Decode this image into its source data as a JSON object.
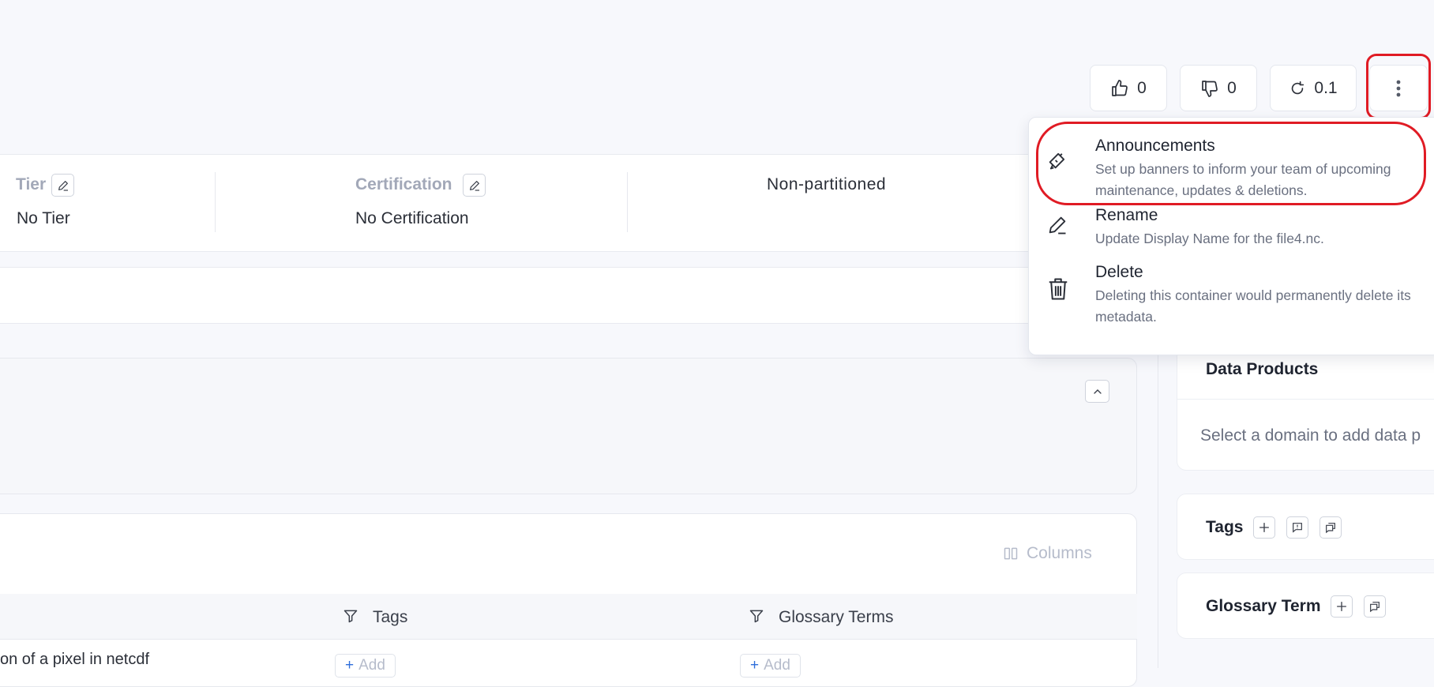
{
  "actions": {
    "upvote_count": "0",
    "downvote_count": "0",
    "version": "0.1"
  },
  "summary": {
    "tier_label": "Tier",
    "tier_value": "No Tier",
    "certification_label": "Certification",
    "certification_value": "No Certification",
    "partition_value": "Non-partitioned"
  },
  "menu": {
    "items": [
      {
        "title": "Announcements",
        "description": "Set up banners to inform your team of upcoming maintenance, updates & deletions.",
        "icon": "megaphone-icon"
      },
      {
        "title": "Rename",
        "description": "Update Display Name for the file4.nc.",
        "icon": "pencil-icon"
      },
      {
        "title": "Delete",
        "description": "Deleting this container would permanently delete its metadata.",
        "icon": "trash-icon"
      }
    ]
  },
  "table": {
    "columns_button": "Columns",
    "headers": {
      "tags": "Tags",
      "glossary_terms": "Glossary Terms"
    },
    "first_row_text": "on of a pixel in netcdf",
    "add_label": "Add"
  },
  "side": {
    "data_products_title": "Data Products",
    "data_products_placeholder": "Select a domain to add data p",
    "tags_title": "Tags",
    "glossary_title": "Glossary Term"
  },
  "colors": {
    "highlight": "#e01b24",
    "page_bg": "#f7f8fc"
  }
}
